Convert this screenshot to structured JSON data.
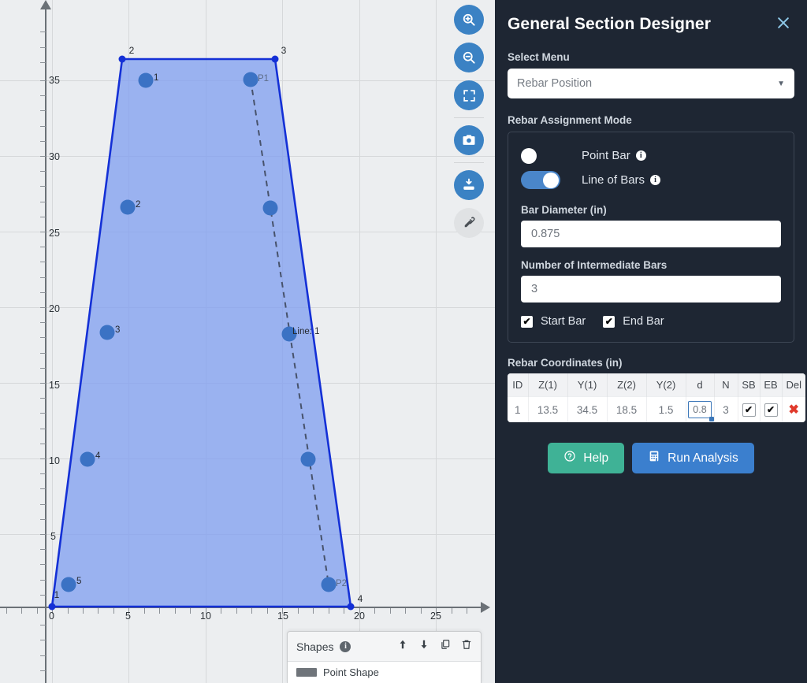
{
  "panel": {
    "title": "General Section Designer",
    "close_icon": "close-icon",
    "select_menu_label": "Select Menu",
    "select_value": "Rebar Position",
    "mode_label": "Rebar Assignment Mode",
    "point_bar_label": "Point Bar",
    "point_bar_on": false,
    "line_of_bars_label": "Line of Bars",
    "line_of_bars_on": true,
    "info_glyph": "i",
    "bar_diameter_label": "Bar Diameter (in)",
    "bar_diameter_value": "0.875",
    "num_intermediate_label": "Number of Intermediate Bars",
    "num_intermediate_value": "3",
    "start_bar_label": "Start Bar",
    "start_bar_checked": true,
    "end_bar_label": "End Bar",
    "end_bar_checked": true,
    "check_glyph": "✔",
    "coords_label": "Rebar Coordinates (in)",
    "table": {
      "headers": [
        "ID",
        "Z(1)",
        "Y(1)",
        "Z(2)",
        "Y(2)",
        "d",
        "N",
        "SB",
        "EB",
        "Del"
      ],
      "rows": [
        {
          "id": "1",
          "z1": "13.5",
          "y1": "34.5",
          "z2": "18.5",
          "y2": "1.5",
          "d": "0.8",
          "n": "3",
          "sb": "✔",
          "eb": "✔",
          "del": "✖"
        }
      ]
    },
    "help_label": "Help",
    "help_icon": "question-circle-icon",
    "run_label": "Run Analysis",
    "run_icon": "calculator-icon",
    "accent_blue": "#3b7fce",
    "accent_teal": "#3fb296",
    "background": "#1e2633"
  },
  "toolbar": {
    "items": [
      {
        "name": "zoom-in-icon",
        "label": "Zoom In",
        "disabled": false
      },
      {
        "name": "zoom-out-icon",
        "label": "Zoom Out",
        "disabled": false
      },
      {
        "name": "fit-screen-icon",
        "label": "Fit to Screen",
        "disabled": false
      },
      {
        "name": "camera-icon",
        "label": "Screenshot",
        "disabled": false
      },
      {
        "name": "download-icon",
        "label": "Download",
        "disabled": false
      },
      {
        "name": "eyedropper-icon",
        "label": "Pick Color",
        "disabled": true
      }
    ]
  },
  "shapes_panel": {
    "title": "Shapes",
    "info_glyph": "i",
    "actions": [
      "move-up-icon",
      "move-down-icon",
      "duplicate-icon",
      "delete-icon"
    ],
    "row_label": "Point Shape"
  },
  "chart_data": {
    "type": "scatter",
    "title": "",
    "xlabel": "",
    "ylabel": "",
    "xlim": [
      -3,
      29
    ],
    "ylim": [
      -2,
      39
    ],
    "xticks": [
      0,
      5,
      10,
      15,
      20,
      25
    ],
    "yticks": [
      0,
      5,
      10,
      15,
      20,
      25,
      30,
      35
    ],
    "grid": true,
    "legend": "none",
    "polygon": {
      "name": "section-outline",
      "fill": "#7f9ef0",
      "stroke": "#1430d6",
      "vertices": [
        {
          "label": "1",
          "x": 0,
          "y": 0
        },
        {
          "label": "2",
          "x": 5.1,
          "y": 36.0
        },
        {
          "label": "3",
          "x": 15.1,
          "y": 36.0
        },
        {
          "label": "4",
          "x": 19.9,
          "y": 0
        }
      ]
    },
    "point_bars": [
      {
        "label": "1",
        "x": 6.3,
        "y": 35.0
      },
      {
        "label": "2",
        "x": 5.2,
        "y": 26.6
      },
      {
        "label": "3",
        "x": 3.9,
        "y": 18.5
      },
      {
        "label": "4",
        "x": 2.6,
        "y": 10.4
      },
      {
        "label": "5",
        "x": 1.4,
        "y": 2.0
      },
      {
        "label": "Line: 1",
        "x": 16.4,
        "y": 18.2
      }
    ],
    "line_of_bars": {
      "label_start": "P1",
      "label_end": "P2",
      "start": {
        "x": 13.5,
        "y": 34.5
      },
      "end": {
        "x": 18.5,
        "y": 1.5
      },
      "intermediate": 3,
      "style": "dashed"
    }
  }
}
